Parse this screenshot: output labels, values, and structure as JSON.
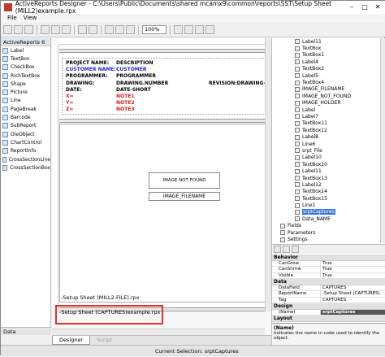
{
  "window": {
    "title": "ActiveReports Designer - C:\\Users\\Public\\Documents\\shared mcamx9\\common\\reports\\SST\\Setup Sheet (MILL2)example.rpx"
  },
  "menu": [
    "File",
    "View"
  ],
  "toolbar": {
    "zoom": "100%"
  },
  "toolbox": {
    "header": "ActiveReports 6",
    "items": [
      "Label",
      "TextBox",
      "CheckBox",
      "RichTextBox",
      "Shape",
      "Picture",
      "Line",
      "PageBreak",
      "Barcode",
      "SubReport",
      "OleObject",
      "ChartControl",
      "ReportInfo",
      "CrossSectionLine",
      "CrossSectionBox"
    ],
    "footer": "Data"
  },
  "report": {
    "rows": [
      {
        "label": "PROJECT NAME:",
        "value": "DESCRIPTION",
        "color": "#000000"
      },
      {
        "label": "CUSTOMER NAME:",
        "value": "CUSTOMER",
        "color": "#1f2bd8"
      },
      {
        "label": "PROGRAMMER:",
        "value": "PROGRAMMER",
        "color": "#000000"
      },
      {
        "label": "DRAWING:",
        "value": "DRAWING.NUMBER",
        "extra": "REVISION:DRAWING-F",
        "color": "#000000"
      },
      {
        "label": "DATE:",
        "value": "DATE-SHORT",
        "color": "#000000"
      },
      {
        "label": "X=",
        "value": "NOTE1",
        "color": "#d42020"
      },
      {
        "label": "Y=",
        "value": "NOTE2",
        "color": "#d42020"
      },
      {
        "label": "Z=",
        "value": "NOTE3",
        "color": "#d42020"
      }
    ],
    "image_not_found": "IMAGE NOT FOUND",
    "image_filename": "IMAGE_FILENAME",
    "subreport1": "-Setup Sheet (MILL2-FILE).rpx",
    "subreport2": "-Setup Sheet (CAPTURES)example.rpx"
  },
  "tabs": {
    "designer": "Designer",
    "script": "Script"
  },
  "tree": {
    "nodes": [
      "Label11",
      "TextBox",
      "TextBox1",
      "Label4",
      "TextBox2",
      "Label5",
      "TextBox4",
      "IMAGE_FILENAME",
      "IMAGE_NOT_FOUND",
      "IMAGE_HOLDER",
      "Label",
      "Label7",
      "TextBox11",
      "TextBox12",
      "Label8",
      "Line6",
      "srpt_File",
      "Label10",
      "TextBox10",
      "Label11",
      "TextBox13",
      "Label12",
      "TextBox14",
      "TextBox15",
      "Line1"
    ],
    "selected": "srptCaptures",
    "after": "Data_NAME",
    "fields": "Fields",
    "parameters": "Parameters",
    "settings": "Settings"
  },
  "properties": {
    "categories": [
      {
        "name": "Behavior",
        "rows": [
          {
            "k": "CanGrow",
            "v": "True"
          },
          {
            "k": "CanShrink",
            "v": "True"
          },
          {
            "k": "Visible",
            "v": "True"
          }
        ]
      },
      {
        "name": "Data",
        "rows": [
          {
            "k": "DataField",
            "v": "CAPTURES"
          },
          {
            "k": "ReportName",
            "v": "-Setup Sheet (CAPTURES)"
          },
          {
            "k": "Tag",
            "v": "CAPTURES"
          }
        ]
      },
      {
        "name": "Design",
        "rows": [
          {
            "k": "(Name)",
            "v": "srptCaptures",
            "hl": true
          }
        ]
      },
      {
        "name": "Layout",
        "rows": []
      }
    ],
    "desc_title": "(Name)",
    "desc_text": "Indicates the name in code used to identify the object."
  },
  "status": {
    "text": "Current Selection: srptCaptures"
  }
}
